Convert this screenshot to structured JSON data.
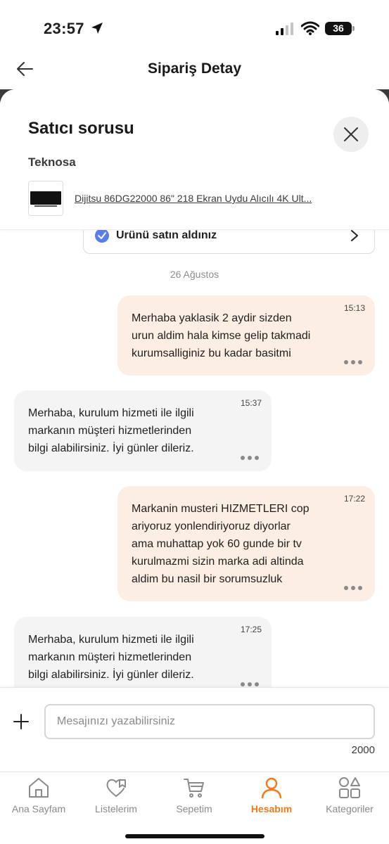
{
  "status_bar": {
    "time": "23:57",
    "battery": "36"
  },
  "header": {
    "title": "Sipariş Detay"
  },
  "sheet": {
    "title": "Satıcı sorusu",
    "seller": "Teknosa",
    "product_name": "Dijitsu 86DG22000 86\" 218 Ekran Uydu Alıcılı 4K Ult..."
  },
  "purchased": {
    "label": "Ürünü satın aldınız"
  },
  "date_separator": "26 Ağustos",
  "messages": [
    {
      "side": "out",
      "time": "15:13",
      "text": "Merhaba yaklasik 2 aydir sizden\nurun aldim hala kimse gelip takmadi\nkurumsalliginiz bu kadar basitmi"
    },
    {
      "side": "in",
      "time": "15:37",
      "text": "Merhaba, kurulum hizmeti ile ilgili\nmarkanın müşteri hizmetlerinden\nbilgi alabilirsiniz. İyi günler dileriz."
    },
    {
      "side": "out",
      "time": "17:22",
      "text": "Markanin musteri HIZMETLERI cop\nariyoruz yonlendiriyoruz diyorlar\nama muhattap yok 60 gunde bir tv\nkurulmazmi sizin marka adi altinda\naldim bu nasil bir sorumsuzluk"
    },
    {
      "side": "in",
      "time": "17:25",
      "text": "Merhaba, kurulum hizmeti ile ilgili\nmarkanın müşteri hizmetlerinden\nbilgi alabilirsiniz. İyi günler dileriz."
    }
  ],
  "composer": {
    "placeholder": "Mesajınızı yazabilirsiniz",
    "value": "",
    "char_limit": "2000"
  },
  "bottom_nav": {
    "items": [
      {
        "label": "Ana Sayfam",
        "icon": "home-icon",
        "active": false
      },
      {
        "label": "Listelerim",
        "icon": "heart-list-icon",
        "active": false
      },
      {
        "label": "Sepetim",
        "icon": "cart-icon",
        "active": false
      },
      {
        "label": "Hesabım",
        "icon": "user-icon",
        "active": true
      },
      {
        "label": "Kategoriler",
        "icon": "categories-icon",
        "active": false
      }
    ]
  },
  "colors": {
    "accent": "#f27a1a",
    "outgoing_bubble": "#fdeee3",
    "incoming_bubble": "#f4f4f4",
    "check": "#5b7cf0"
  }
}
